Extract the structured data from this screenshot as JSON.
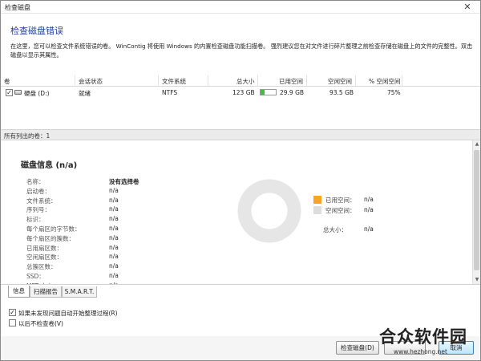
{
  "window": {
    "title": "检查磁盘"
  },
  "header": {
    "title": "检查磁盘错误",
    "description": "在这里，您可以检查文件系统错误的卷。 WinContig 将使用 Windows 的内置检查磁盘功能扫描卷。 强烈建议您在对文件进行碎片整理之前检查存储在磁盘上的文件的完整性。双击磁盘以显示其属性。"
  },
  "columns": [
    "卷",
    "会话状态",
    "文件系统",
    "总大小",
    "已用空间",
    "空闲空间",
    "% 空闲空间"
  ],
  "volumes": [
    {
      "checked": true,
      "name": "硬盘 (D:)",
      "status": "就绪",
      "filesystem": "NTFS",
      "total": "123 GB",
      "used": "29.9 GB",
      "used_fraction": 0.243,
      "free": "93.5 GB",
      "free_pct": "75%"
    }
  ],
  "status_bar": {
    "text": "所有列出的卷：1"
  },
  "disk_info": {
    "title": "磁盘信息 (n/a)",
    "properties": [
      {
        "label": "名称：",
        "value": "没有选择卷"
      },
      {
        "label": "启动卷：",
        "value": "n/a"
      },
      {
        "label": "文件系统：",
        "value": "n/a"
      },
      {
        "label": "序列号：",
        "value": "n/a"
      },
      {
        "label": "标识：",
        "value": "n/a"
      },
      {
        "label": "每个扇区的字节数：",
        "value": "n/a"
      },
      {
        "label": "每个扇区的簇数：",
        "value": "n/a"
      },
      {
        "label": "已用扇区数：",
        "value": "n/a"
      },
      {
        "label": "空闲扇区数：",
        "value": "n/a"
      },
      {
        "label": "总簇区数：",
        "value": "n/a"
      },
      {
        "label": "SSD：",
        "value": "n/a"
      },
      {
        "label": "MFT 大小：",
        "value": "n/a"
      }
    ],
    "legend": {
      "used_label": "已用空间：",
      "used_value": "n/a",
      "used_color": "#f5a623",
      "free_label": "空闲空间：",
      "free_value": "n/a",
      "free_color": "#dddddd",
      "total_label": "总大小：",
      "total_value": "n/a"
    },
    "donut_color": "#e6e6e6"
  },
  "tabs": [
    "信息",
    "扫描报告",
    "S.M.A.R.T."
  ],
  "active_tab": 0,
  "options": [
    {
      "label": "如果未发现问题自动开始整理过程(R)",
      "checked": true
    },
    {
      "label": "以后不检查卷(V)",
      "checked": false
    }
  ],
  "buttons": {
    "check_disk": "检查磁盘(D)",
    "cancel": "取消"
  },
  "watermark": {
    "title": "合众软件园",
    "url": "www.hezhong.net"
  }
}
